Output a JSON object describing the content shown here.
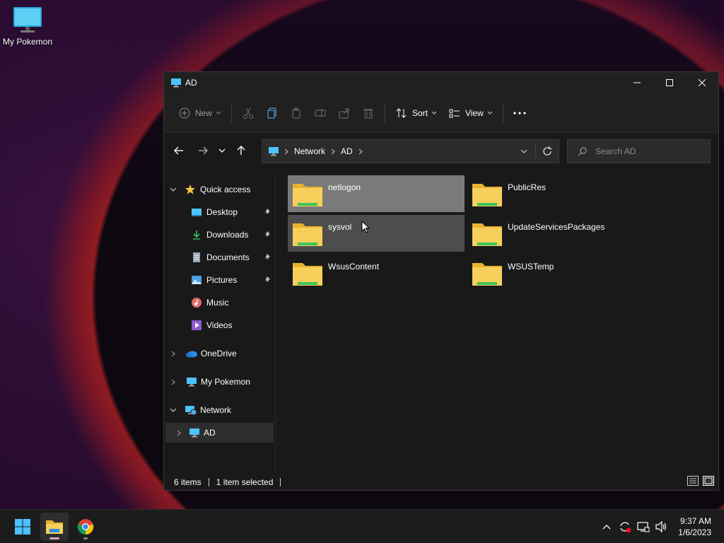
{
  "desktop": {
    "icon_label": "My Pokemon"
  },
  "window": {
    "title": "AD",
    "toolbar": {
      "new_label": "New",
      "sort_label": "Sort",
      "view_label": "View"
    },
    "address": {
      "segments": [
        "Network",
        "AD"
      ]
    },
    "search": {
      "placeholder": "Search AD"
    },
    "sidebar": {
      "quick_access": "Quick access",
      "pinned": [
        "Desktop",
        "Downloads",
        "Documents",
        "Pictures"
      ],
      "music": "Music",
      "videos": "Videos",
      "onedrive": "OneDrive",
      "my_pokemon": "My Pokemon",
      "network": "Network",
      "ad": "AD"
    },
    "folders": [
      {
        "name": "netlogon",
        "state": "selected"
      },
      {
        "name": "PublicRes",
        "state": "normal"
      },
      {
        "name": "sysvol",
        "state": "hover"
      },
      {
        "name": "UpdateServicesPackages",
        "state": "normal"
      },
      {
        "name": "WsusContent",
        "state": "normal"
      },
      {
        "name": "WSUSTemp",
        "state": "normal"
      }
    ],
    "status": {
      "items": "6 items",
      "selected": "1 item selected"
    }
  },
  "taskbar": {
    "time": "9:37 AM",
    "date": "1/6/2023"
  },
  "colors": {
    "accent": "#4cc2ff",
    "folder": "#f5c542",
    "folder_stripe": "#3bc45a"
  }
}
